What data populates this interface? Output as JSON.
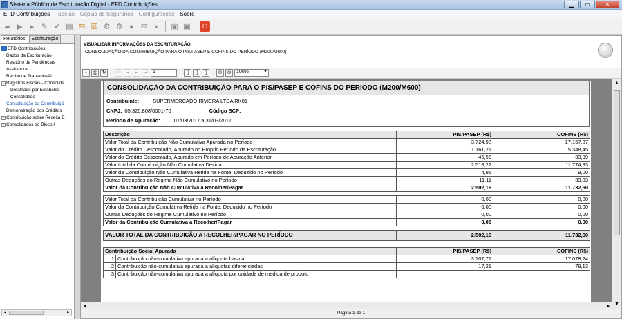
{
  "window": {
    "title": "Sistema Público de Escrituração Digital - EFD Contribuições",
    "min": "▁",
    "max": "▭",
    "close": "✕"
  },
  "menu": [
    "EFD Contribuições",
    "Tabelas",
    "Cópias de Segurança",
    "Configurações",
    "Sobre"
  ],
  "toolbar_icons": [
    "new-icon",
    "open-icon",
    "import-icon",
    "sign-icon",
    "validate-icon",
    "edit-icon",
    "report-icon",
    "delete-icon",
    "transmit-icon",
    "receipt-icon",
    "cd-icon",
    "print-icon",
    "config-icon",
    "save-icon",
    "exit-icon"
  ],
  "left": {
    "tabs": [
      "Relatórios",
      "Escrituração"
    ],
    "tree": [
      {
        "label": "EFD Contribuições",
        "level": 0
      },
      {
        "label": "Dados da Escrituração",
        "level": 1
      },
      {
        "label": "Relatório de Pendências",
        "level": 1
      },
      {
        "label": "Assinatura",
        "level": 1
      },
      {
        "label": "Recibo de Transmissão",
        "level": 1
      },
      {
        "label": "Registros Fiscais - Consolida",
        "level": 1
      },
      {
        "label": "Detalhado por Estabelec",
        "level": 2
      },
      {
        "label": "Consolidado",
        "level": 2
      },
      {
        "label": "Consolidação da Contribuiçã",
        "level": 1
      },
      {
        "label": "Demonstração dos Créditos",
        "level": 1
      },
      {
        "label": "Contribuição sobre Receita B",
        "level": 1
      },
      {
        "label": "Consolidados do Bloco I",
        "level": 1
      }
    ]
  },
  "header": {
    "title": "VISUALIZAR INFORMAÇÕES DA ESCRITURAÇÃO",
    "subtitle": "CONSOLIDAÇÃO DA CONTRIBUIÇÃO PARA O PIS/PASEP E COFINS DO PERÍODO (M200/M600)"
  },
  "report_toolbar": {
    "page": "1",
    "zoom": "100%"
  },
  "report": {
    "title": "CONSOLIDAÇÃO DA CONTRIBUIÇÃO PARA O PIS/PASEP E COFINS DO PERÍODO (M200/M600)",
    "contribuinte_label": "Contribuinte:",
    "contribuinte": "SUPERMERCADO RIVIERA LTDA RK01",
    "cnpj_label": "CNPJ:",
    "cnpj": "05.320.808/0001-70",
    "scp_label": "Código SCP:",
    "periodo_label": "Período de Apuração:",
    "periodo": "01/03/2017 a 31/03/2017",
    "col_desc": "Descrição",
    "col_pis": "PIS/PASEP (R$)",
    "col_cofins": "COFINS (R$)",
    "rows1": [
      {
        "d": "Valor Total da Contribuição Não Cumulativa Apurada no Período",
        "p": "3.724,98",
        "c": "17.157,37"
      },
      {
        "d": "Valor do Crédito Descontado, Apurado no Próprio Período da Escrituração",
        "p": "1.161,21",
        "c": "5.348,45"
      },
      {
        "d": "Valor do Crédito Descontado, Apurado em Período de Apuração Anterior",
        "p": "45,55",
        "c": "33,99"
      },
      {
        "d": "Valor total da Contribuição Não Cumulativa Devida",
        "p": "2.518,22",
        "c": "11.774,93"
      },
      {
        "d": "Valor da Contribuição Não Cumulativa Retida na Fonte, Deduzido no Período",
        "p": "4,95",
        "c": "9,00"
      },
      {
        "d": "Outras Deduções do Regime Não Cumulativo no Período",
        "p": "11,11",
        "c": "33,33"
      }
    ],
    "total1": {
      "d": "Valor da Contribuição Não Cumulativa a Recolher/Pagar",
      "p": "2.502,16",
      "c": "11.732,60"
    },
    "rows2": [
      {
        "d": "Valor Total da Contribuição Cumulativa no Período",
        "p": "0,00",
        "c": "0,00"
      },
      {
        "d": "Valor da Contribuição Cumulativa Retida na Fonte, Deduzido no Período",
        "p": "0,00",
        "c": "0,00"
      },
      {
        "d": "Outras Deduções do Regime Cumulativo no Período",
        "p": "0,00",
        "c": "0,00"
      }
    ],
    "total2": {
      "d": "Valor da Contribuição Cumulativa a Recolher/Pagar",
      "p": "0,00",
      "c": "0,00"
    },
    "grand": {
      "d": "VALOR TOTAL DA CONTRIBUIÇÃO A RECOLHER/PAGAR NO PERÍODO",
      "p": "2.502,16",
      "c": "11.732,60"
    },
    "social_header": "Contribuição Social Apurada",
    "social": [
      {
        "i": "1",
        "d": "Contribuição não-cumulativa apurada a alíquota básica",
        "p": "3.707,77",
        "c": "17.078,24"
      },
      {
        "i": "2",
        "d": "Contribuição não-cumulativa apurada a alíquotas diferenciadas",
        "p": "17,21",
        "c": "79,13"
      },
      {
        "i": "3",
        "d": "Contribuição não-cumulativa apurada a alíquota por unidade de medida de produto",
        "p": "",
        "c": ""
      }
    ]
  },
  "status": "Página 1 de 1"
}
